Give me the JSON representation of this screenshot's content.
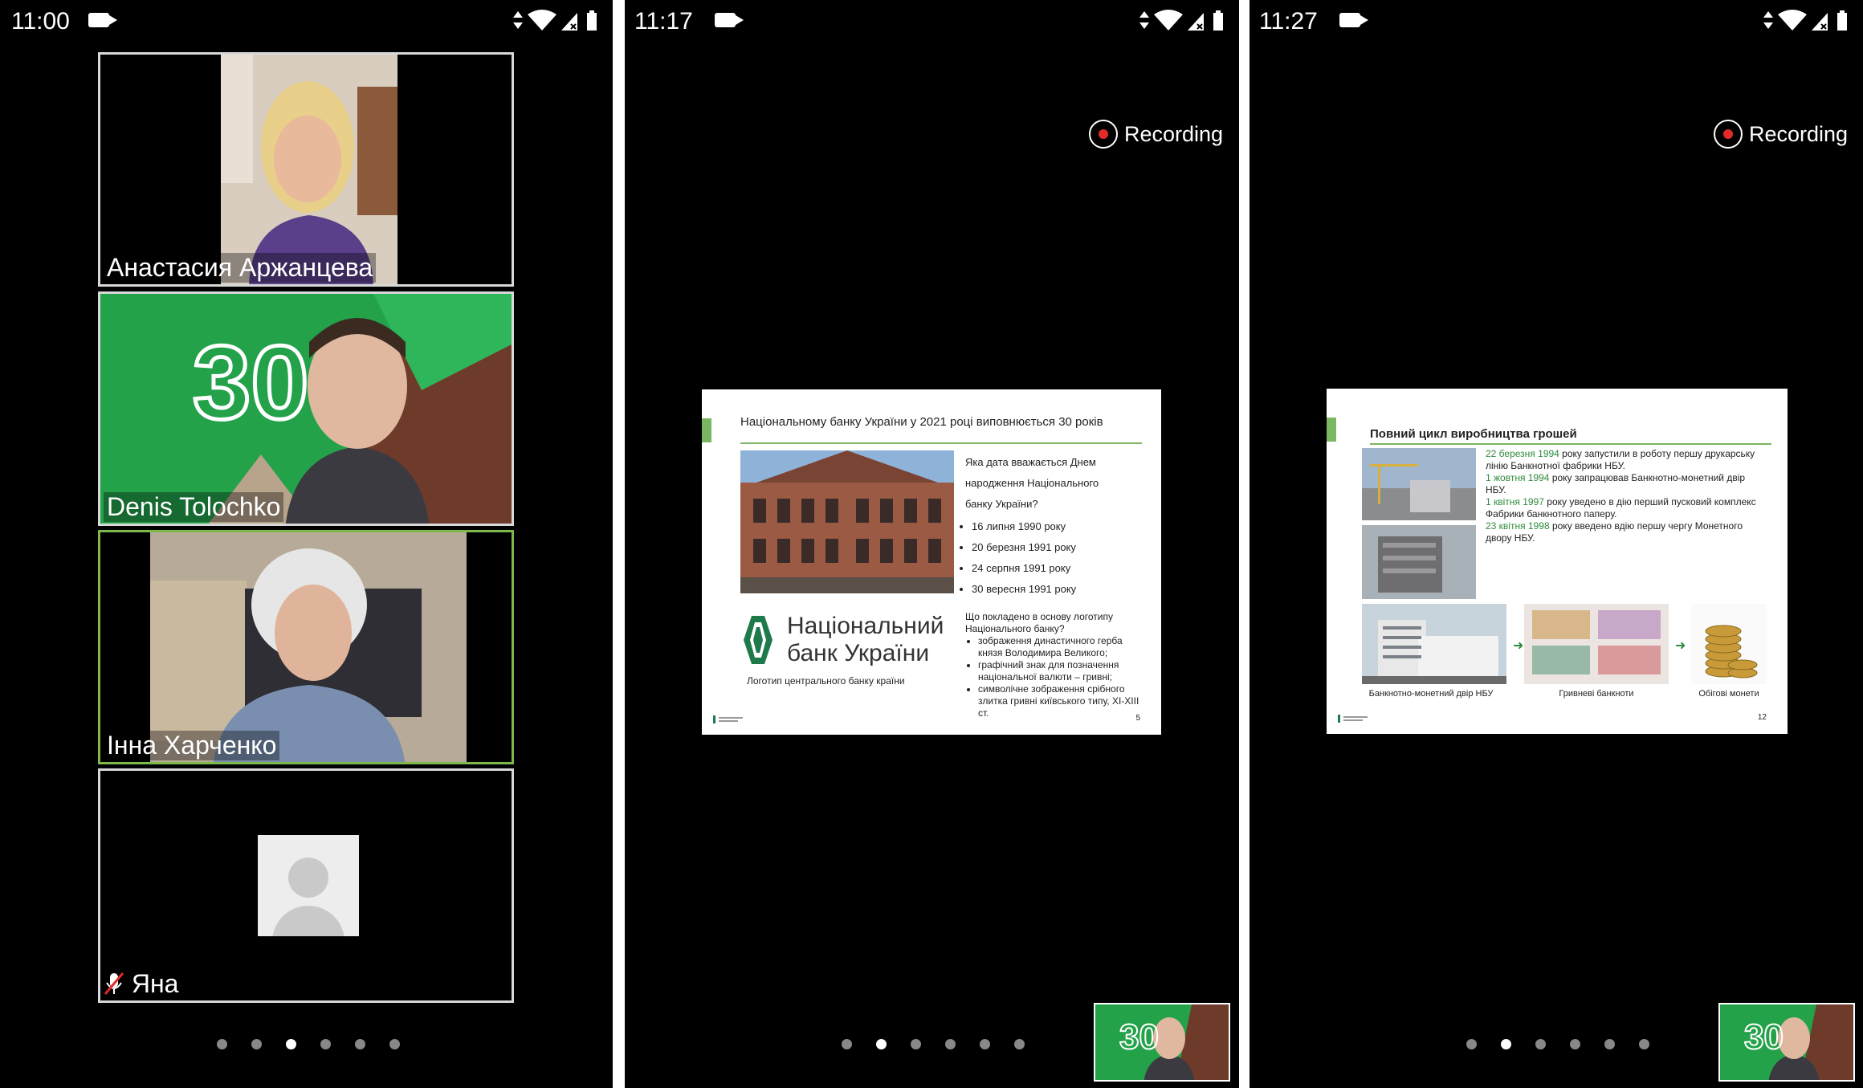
{
  "screens": [
    {
      "time": "11:00",
      "participants": [
        {
          "name": "Анастасия Аржанцева"
        },
        {
          "name": "Denis Tolochko",
          "bg_number": "30"
        },
        {
          "name": "Інна Харченко"
        },
        {
          "name": "Яна",
          "muted_icon": "mic-off-icon"
        }
      ],
      "page_dots": 6,
      "active_dot": 3
    },
    {
      "time": "11:17",
      "recording_label": "Recording",
      "slide": {
        "title": "Національному банку України у 2021 році виповнюється 30 років",
        "question1": "Яка дата вважається Днем народження Національного банку України?",
        "options1": [
          "16 липня 1990 року",
          "20 березня 1991 року",
          "24 серпня 1991 року",
          "30 вересня 1991 року"
        ],
        "logo_line1": "Національний",
        "logo_line2": "банк України",
        "logo_caption": "Логотип центрального банку країни",
        "question2": "Що покладено в основу логотипу Національного банку?",
        "options2": [
          "зображення династичного герба князя Володимира Великого;",
          "графічний знак для позначення національної валюти – гривні;",
          "символічне зображення срібного злитка гривні київського типу, XI-XIII ст."
        ],
        "page_number": "5"
      },
      "page_dots": 6,
      "active_dot": 2,
      "mini_number": "30"
    },
    {
      "time": "11:27",
      "recording_label": "Recording",
      "slide": {
        "title": "Повний цикл виробництва грошей",
        "facts": [
          {
            "date": "22 березня 1994",
            "text": " року запустили в роботу першу друкарську лінію Банкнотної фабрики НБУ."
          },
          {
            "date": "1 жовтня 1994",
            "text": " року запрацював Банкнотно-монетний двір НБУ."
          },
          {
            "date": "1 квітня 1997",
            "text": " року уведено в дію перший пусковий комплекс Фабрики банкнотного паперу."
          },
          {
            "date": "23 квітня 1998",
            "text": " року введено вдію першу чергу Монетного двору НБУ."
          }
        ],
        "captions": [
          "Банкнотно-монетний двір НБУ",
          "Гривневі банкноти",
          "Обігові монети"
        ],
        "page_number": "12"
      },
      "page_dots": 6,
      "active_dot": 2,
      "mini_number": "30"
    }
  ],
  "colors": {
    "accent_green": "#7bb662",
    "date_green": "#2e8b3a",
    "record_red": "#e12a2a"
  }
}
